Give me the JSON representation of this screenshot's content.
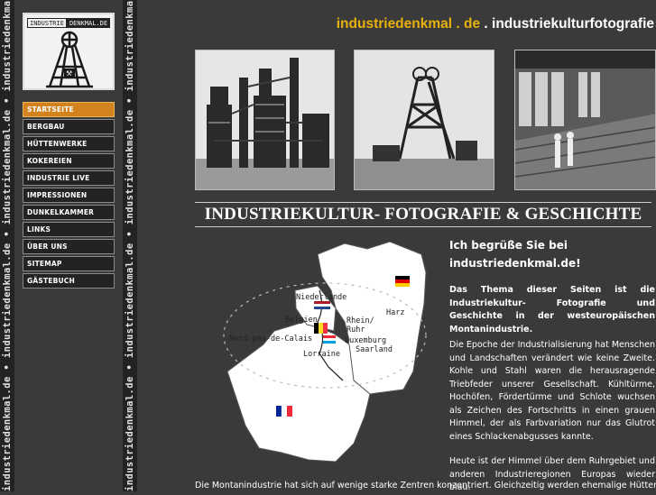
{
  "watermark": {
    "text": "industriedenkmal.de • industriedenkmal.de • industriedenkmal.de • industriedenkmal.de • industriedenkmal.de •"
  },
  "logo": {
    "word_left": "INDUSTRIE",
    "word_right": "DENKMAL.DE"
  },
  "menu": {
    "items": [
      {
        "label": "STARTSEITE",
        "active": true
      },
      {
        "label": "BERGBAU",
        "active": false
      },
      {
        "label": "HÜTTENWERKE",
        "active": false
      },
      {
        "label": "KOKEREIEN",
        "active": false
      },
      {
        "label": "INDUSTRIE LIVE",
        "active": false
      },
      {
        "label": "IMPRESSIONEN",
        "active": false
      },
      {
        "label": "DUNKELKAMMER",
        "active": false
      },
      {
        "label": "LINKS",
        "active": false
      },
      {
        "label": "ÜBER UNS",
        "active": false
      },
      {
        "label": "SITEMAP",
        "active": false
      },
      {
        "label": "GÄSTEBUCH",
        "active": false
      }
    ],
    "active_color": "#d2831f"
  },
  "header": {
    "site_name": "industriedenkmal . de",
    "separator": " . ",
    "subtitle": "industriekulturfotografie",
    "site_name_color": "#e8b10c"
  },
  "photos": [
    {
      "icon": "blast-furnace-photo"
    },
    {
      "icon": "headframe-photo"
    },
    {
      "icon": "industrial-hall-photo"
    }
  ],
  "headline": "INDUSTRIEKULTUR- FOTOGRAFIE & GESCHICHTE",
  "map": {
    "labels": {
      "niederlande": "Niederlande",
      "belgien": "Belgien",
      "rhein_ruhr_1": "Rhein/",
      "rhein_ruhr_2": "Ruhr",
      "harz": "Harz",
      "luxemburg": "Luxemburg",
      "saarland": "Saarland",
      "nord_pas": "Nord-pas-de-Calais",
      "lorraine": "Lorraine"
    }
  },
  "content": {
    "greeting_line1": "Ich begrüße Sie bei",
    "greeting_line2": "industriedenkmal.de!",
    "para1": "Das Thema dieser Seiten ist die Industriekultur- Fotografie und Geschichte in der westeuropäischen Montanindustrie.",
    "para2": "Die Epoche der Industrialisierung hat Menschen und Landschaften verändert wie keine Zweite. Kohle und Stahl waren die herausragende Triebfeder unserer Gesellschaft. Kühltürme, Hochöfen, Fördertürme und Schlote wuchsen als Zeichen des Fortschritts in einen grauen Himmel, der als Farbvariation nur das Glutrot eines Schlackenabgusses kannte.",
    "para3": "Heute ist der Himmel über dem Ruhrgebiet und anderen Industrieregionen Europas wieder blau.",
    "bottom_line": "Die Montanindustrie hat sich auf wenige starke Zentren konzentriert. Gleichzeitig werden ehemalige Hüttenwerke"
  }
}
